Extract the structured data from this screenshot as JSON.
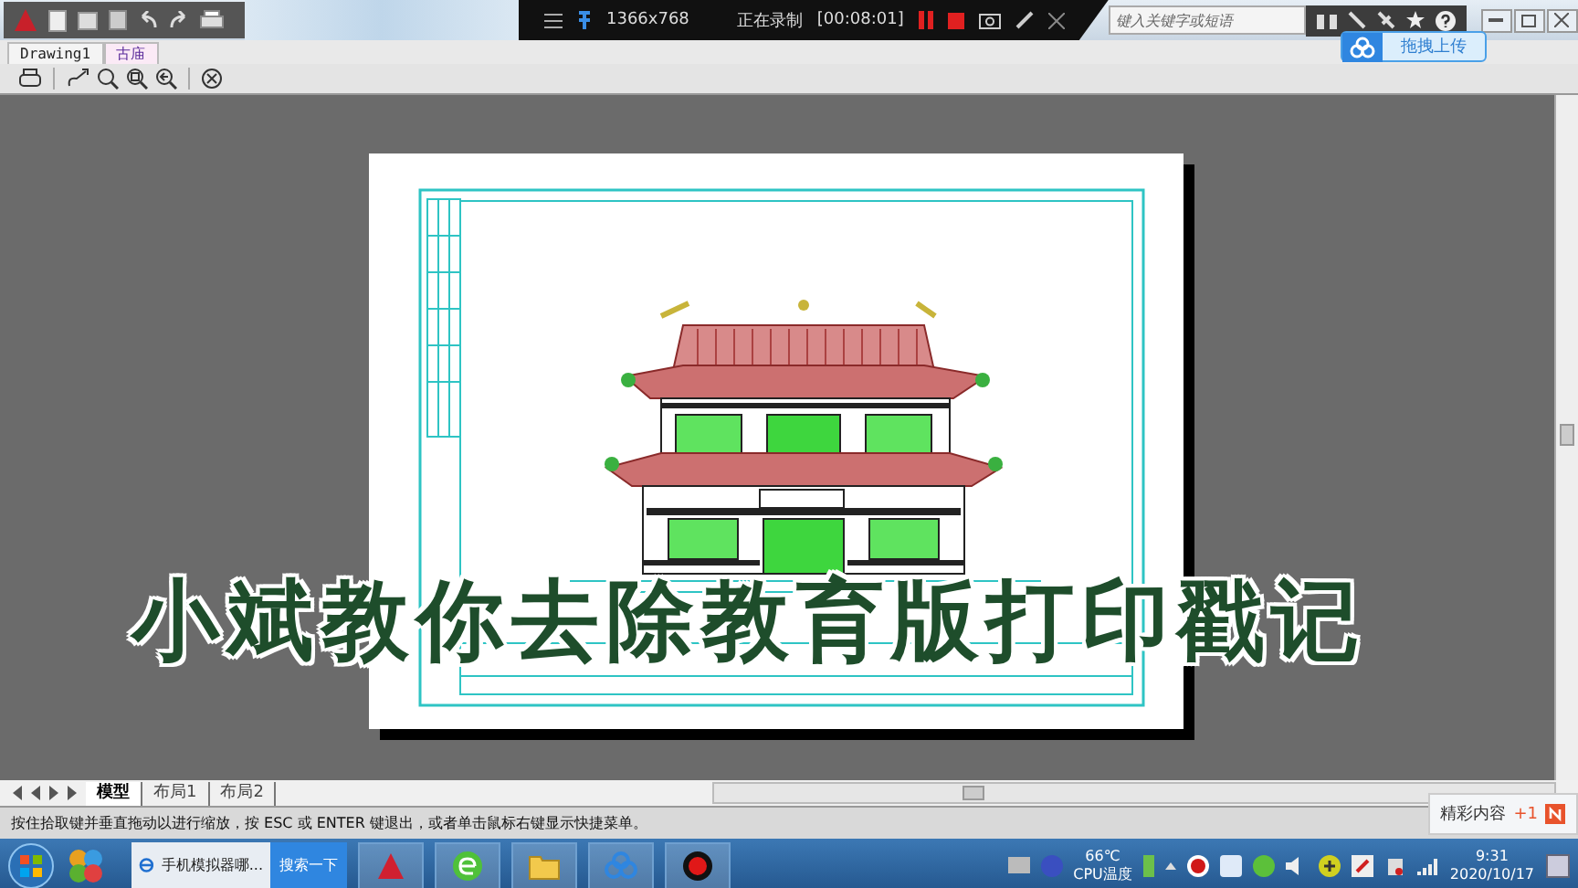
{
  "title_bar": {
    "recording": {
      "resolution": "1366x768",
      "status": "正在录制",
      "timer": "[00:08:01]"
    },
    "search": {
      "placeholder": "键入关键字或短语"
    },
    "upload_badge": "拖拽上传"
  },
  "document_tabs": [
    {
      "label": "Drawing1",
      "selected": false
    },
    {
      "label": "古庙",
      "selected": true
    }
  ],
  "caption": "小斌教你去除教育版打印戳记",
  "layout_tabs": [
    {
      "label": "模型",
      "selected": true
    },
    {
      "label": "布局1",
      "selected": false
    },
    {
      "label": "布局2",
      "selected": false
    }
  ],
  "command_line": "按住拾取键并垂直拖动以进行缩放，按 ESC 或 ENTER 键退出，或者单击鼠标右键显示快捷菜单。",
  "notification": {
    "text": "精彩内容",
    "count": "+1"
  },
  "taskbar": {
    "browser_title": "手机模拟器哪...",
    "search_button": "搜索一下",
    "temperature": "66℃",
    "temperature_label": "CPU温度",
    "time": "9:31",
    "date": "2020/10/17"
  }
}
